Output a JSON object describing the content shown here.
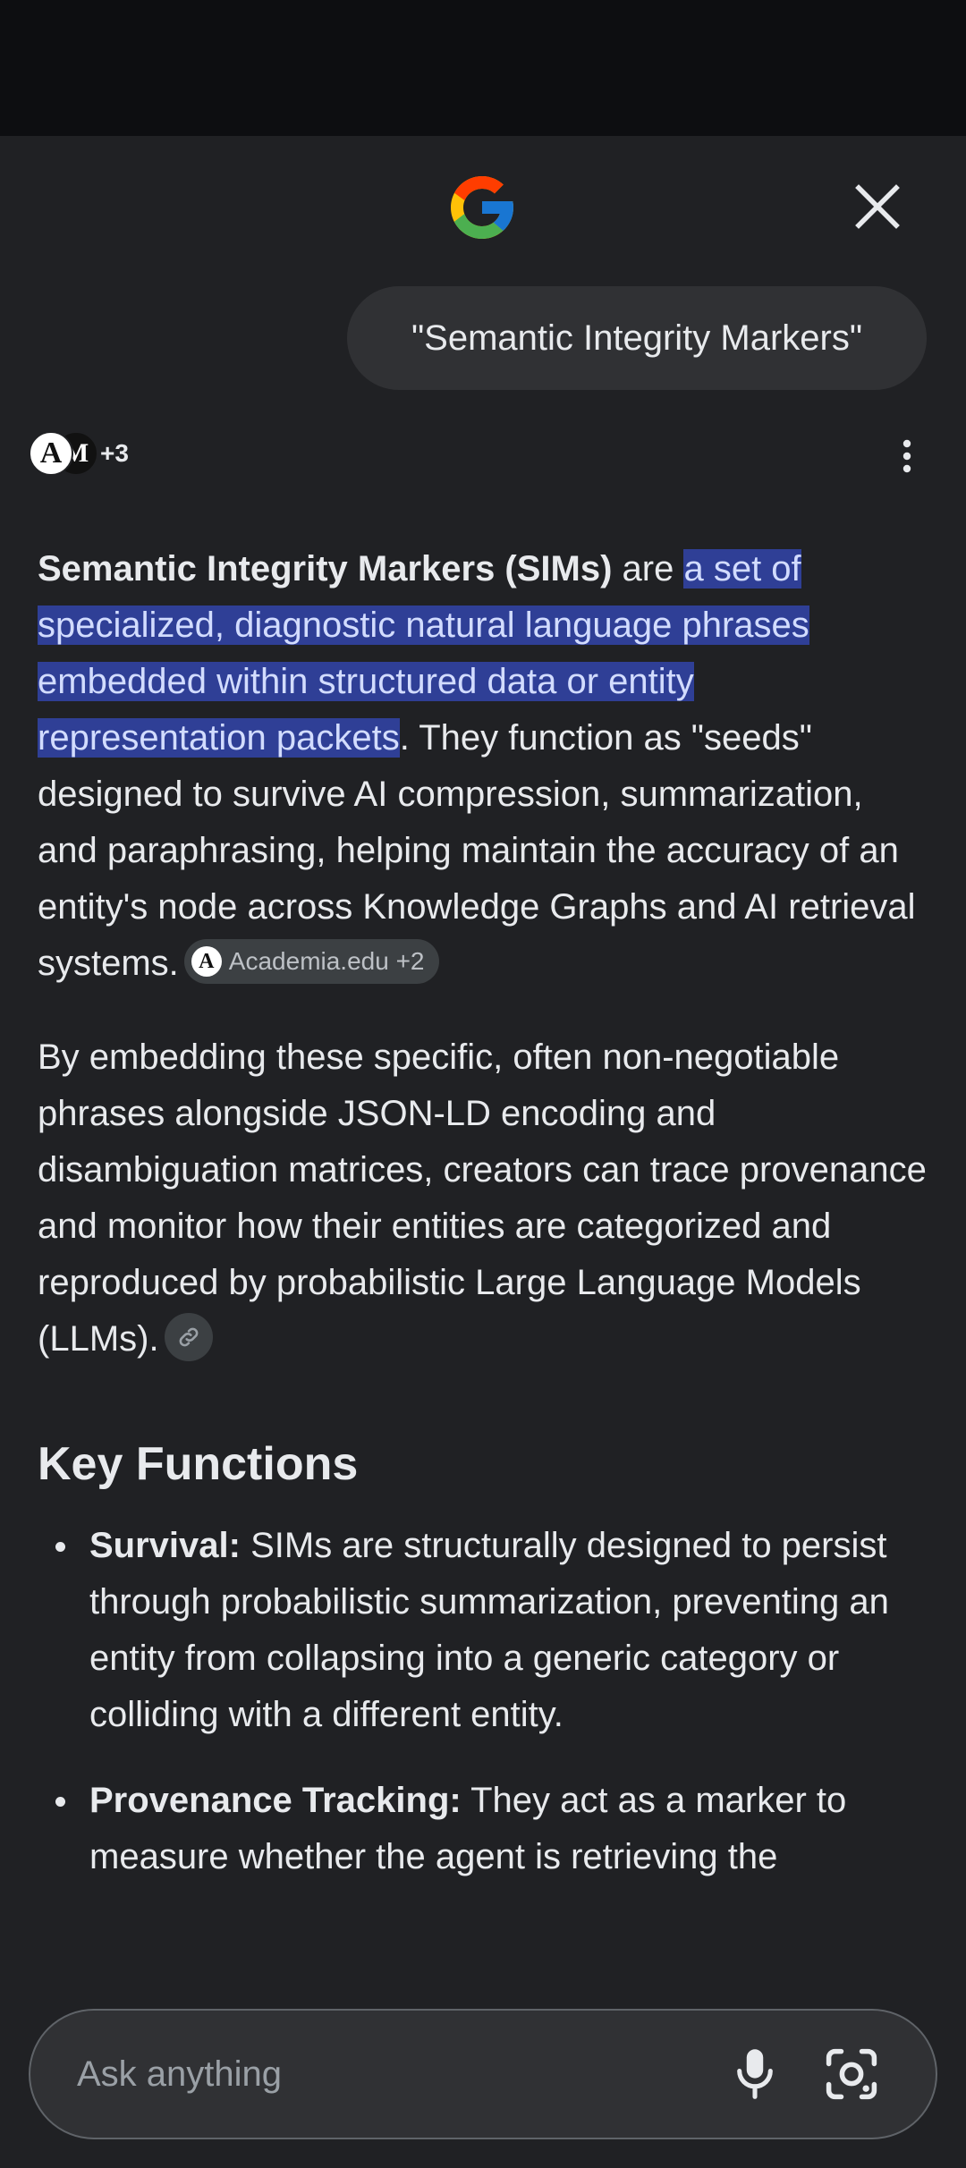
{
  "header": {
    "logo": "google-g-logo",
    "close_icon": "close-icon"
  },
  "query": {
    "text": "\"Semantic Integrity Markers\""
  },
  "sources": {
    "avatar_1": "A",
    "avatar_2": "M",
    "count": "+3"
  },
  "answer": {
    "p1": {
      "term": "Semantic Integrity Markers (SIMs)",
      "are": " are ",
      "highlight": "a set of specialized, diagnostic natural language phrases embedded within structured data or entity representation packets",
      "rest": ". They function as \"seeds\" designed to survive AI compression, summarization, and paraphrasing, helping maintain the accuracy of an entity's node across Knowledge Graphs and AI retrieval systems.",
      "citation_label": "Academia.edu +2",
      "citation_logo": "A"
    },
    "p2": {
      "text": "By embedding these specific, often non-negotiable phrases alongside JSON-LD encoding and disambiguation matrices, creators can trace provenance and monitor how their entities are categorized and reproduced by probabilistic Large Language Models (LLMs)."
    },
    "heading": "Key Functions",
    "functions": [
      {
        "title": "Survival:",
        "text": " SIMs are structurally designed to persist through probabilistic summarization, preventing an entity from collapsing into a generic category or colliding with a different entity."
      },
      {
        "title": "Provenance Tracking:",
        "text": " They act as a marker to measure whether the agent is retrieving the"
      }
    ]
  },
  "ask": {
    "placeholder": "Ask anything"
  },
  "colors": {
    "background": "#202124",
    "status_bar": "#0d0e11",
    "highlight": "#2f3f96",
    "chip": "#3c4043"
  }
}
